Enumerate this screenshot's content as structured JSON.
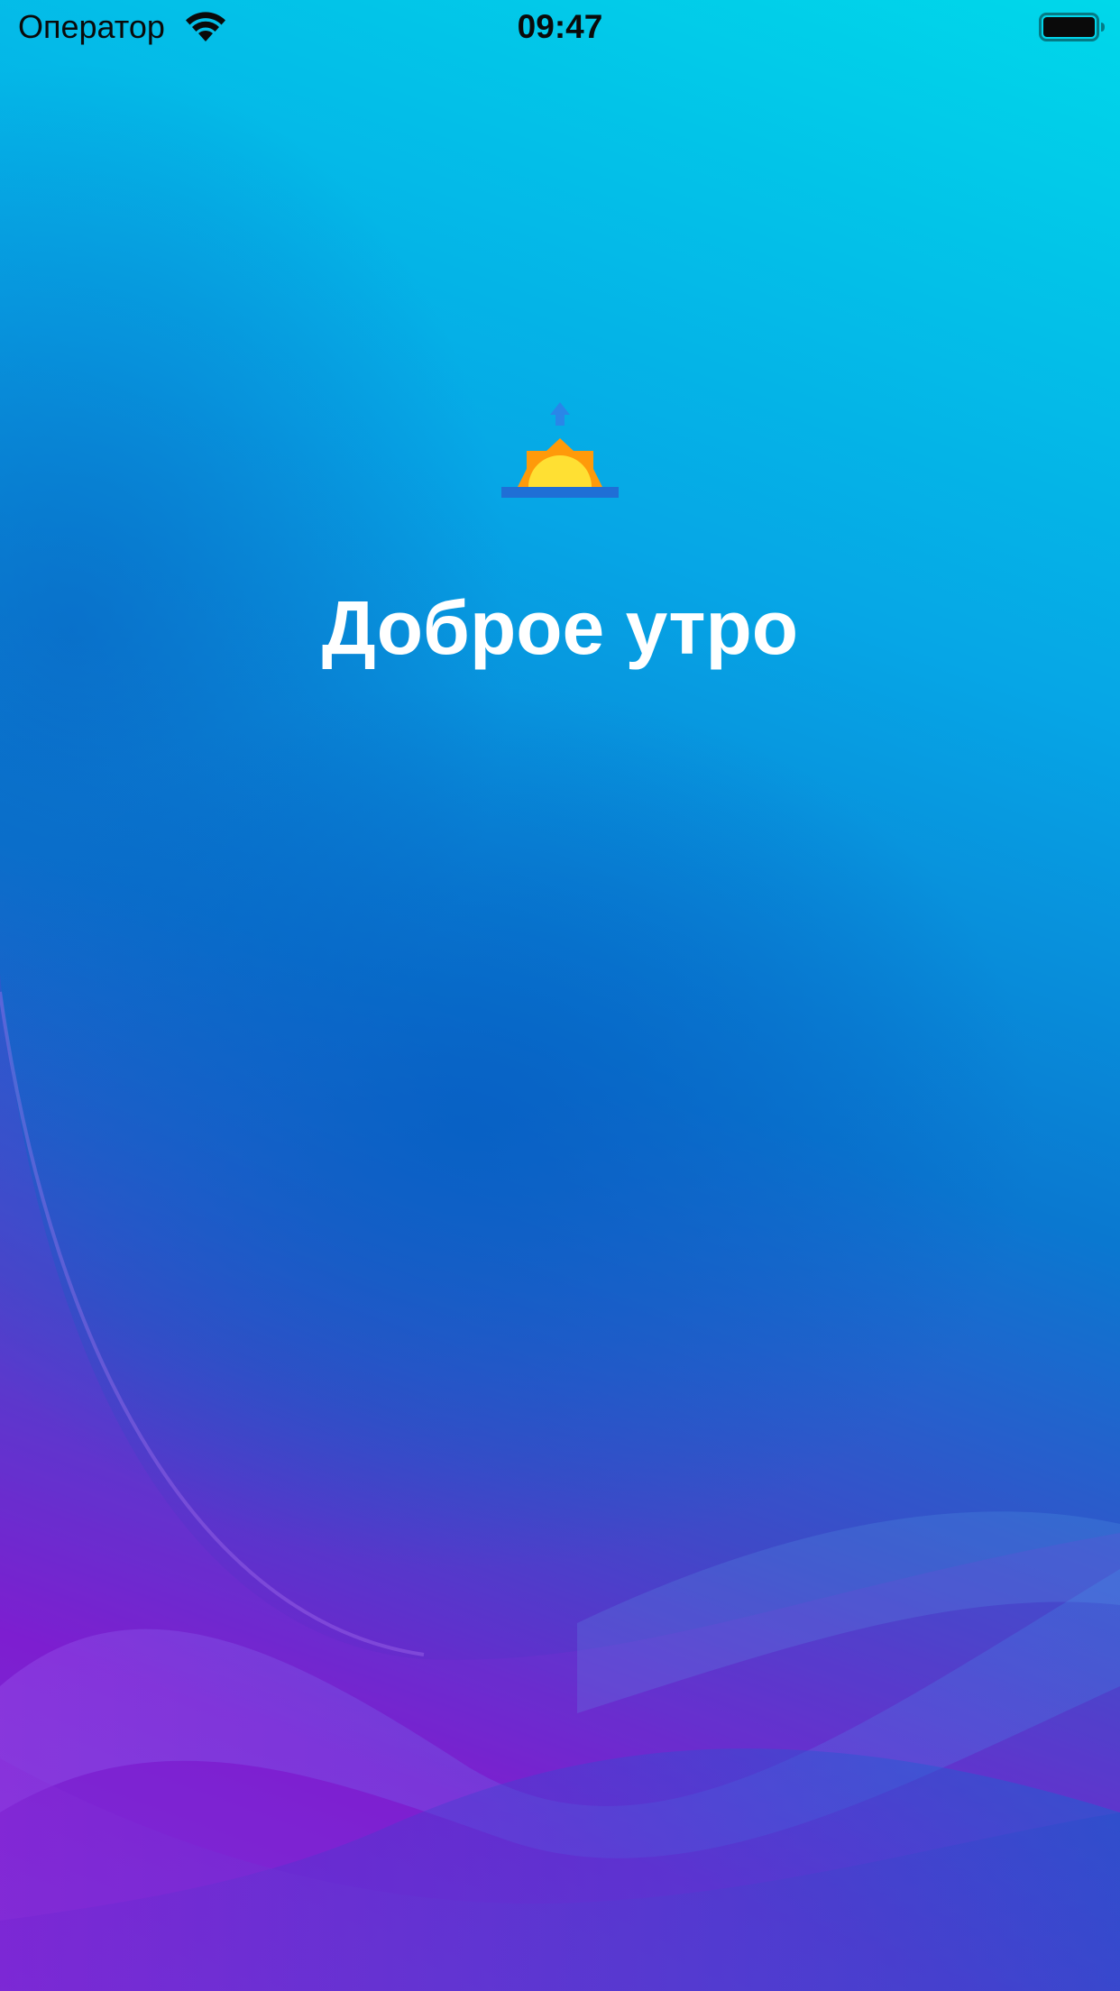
{
  "status_bar": {
    "carrier": "Оператор",
    "time": "09:47",
    "wifi_icon": "wifi-icon",
    "battery_icon": "battery-icon",
    "battery_level": 1.0
  },
  "main": {
    "icon": "sunrise-icon",
    "greeting": "Доброе утро"
  },
  "colors": {
    "gradient_top": "#00d8ea",
    "gradient_mid": "#0a78d0",
    "gradient_bottom": "#7a1ccf",
    "sun_yellow": "#ffe033",
    "sun_orange": "#ff9a0a",
    "horizon_blue": "#1f6fd6",
    "text": "#ffffff"
  }
}
